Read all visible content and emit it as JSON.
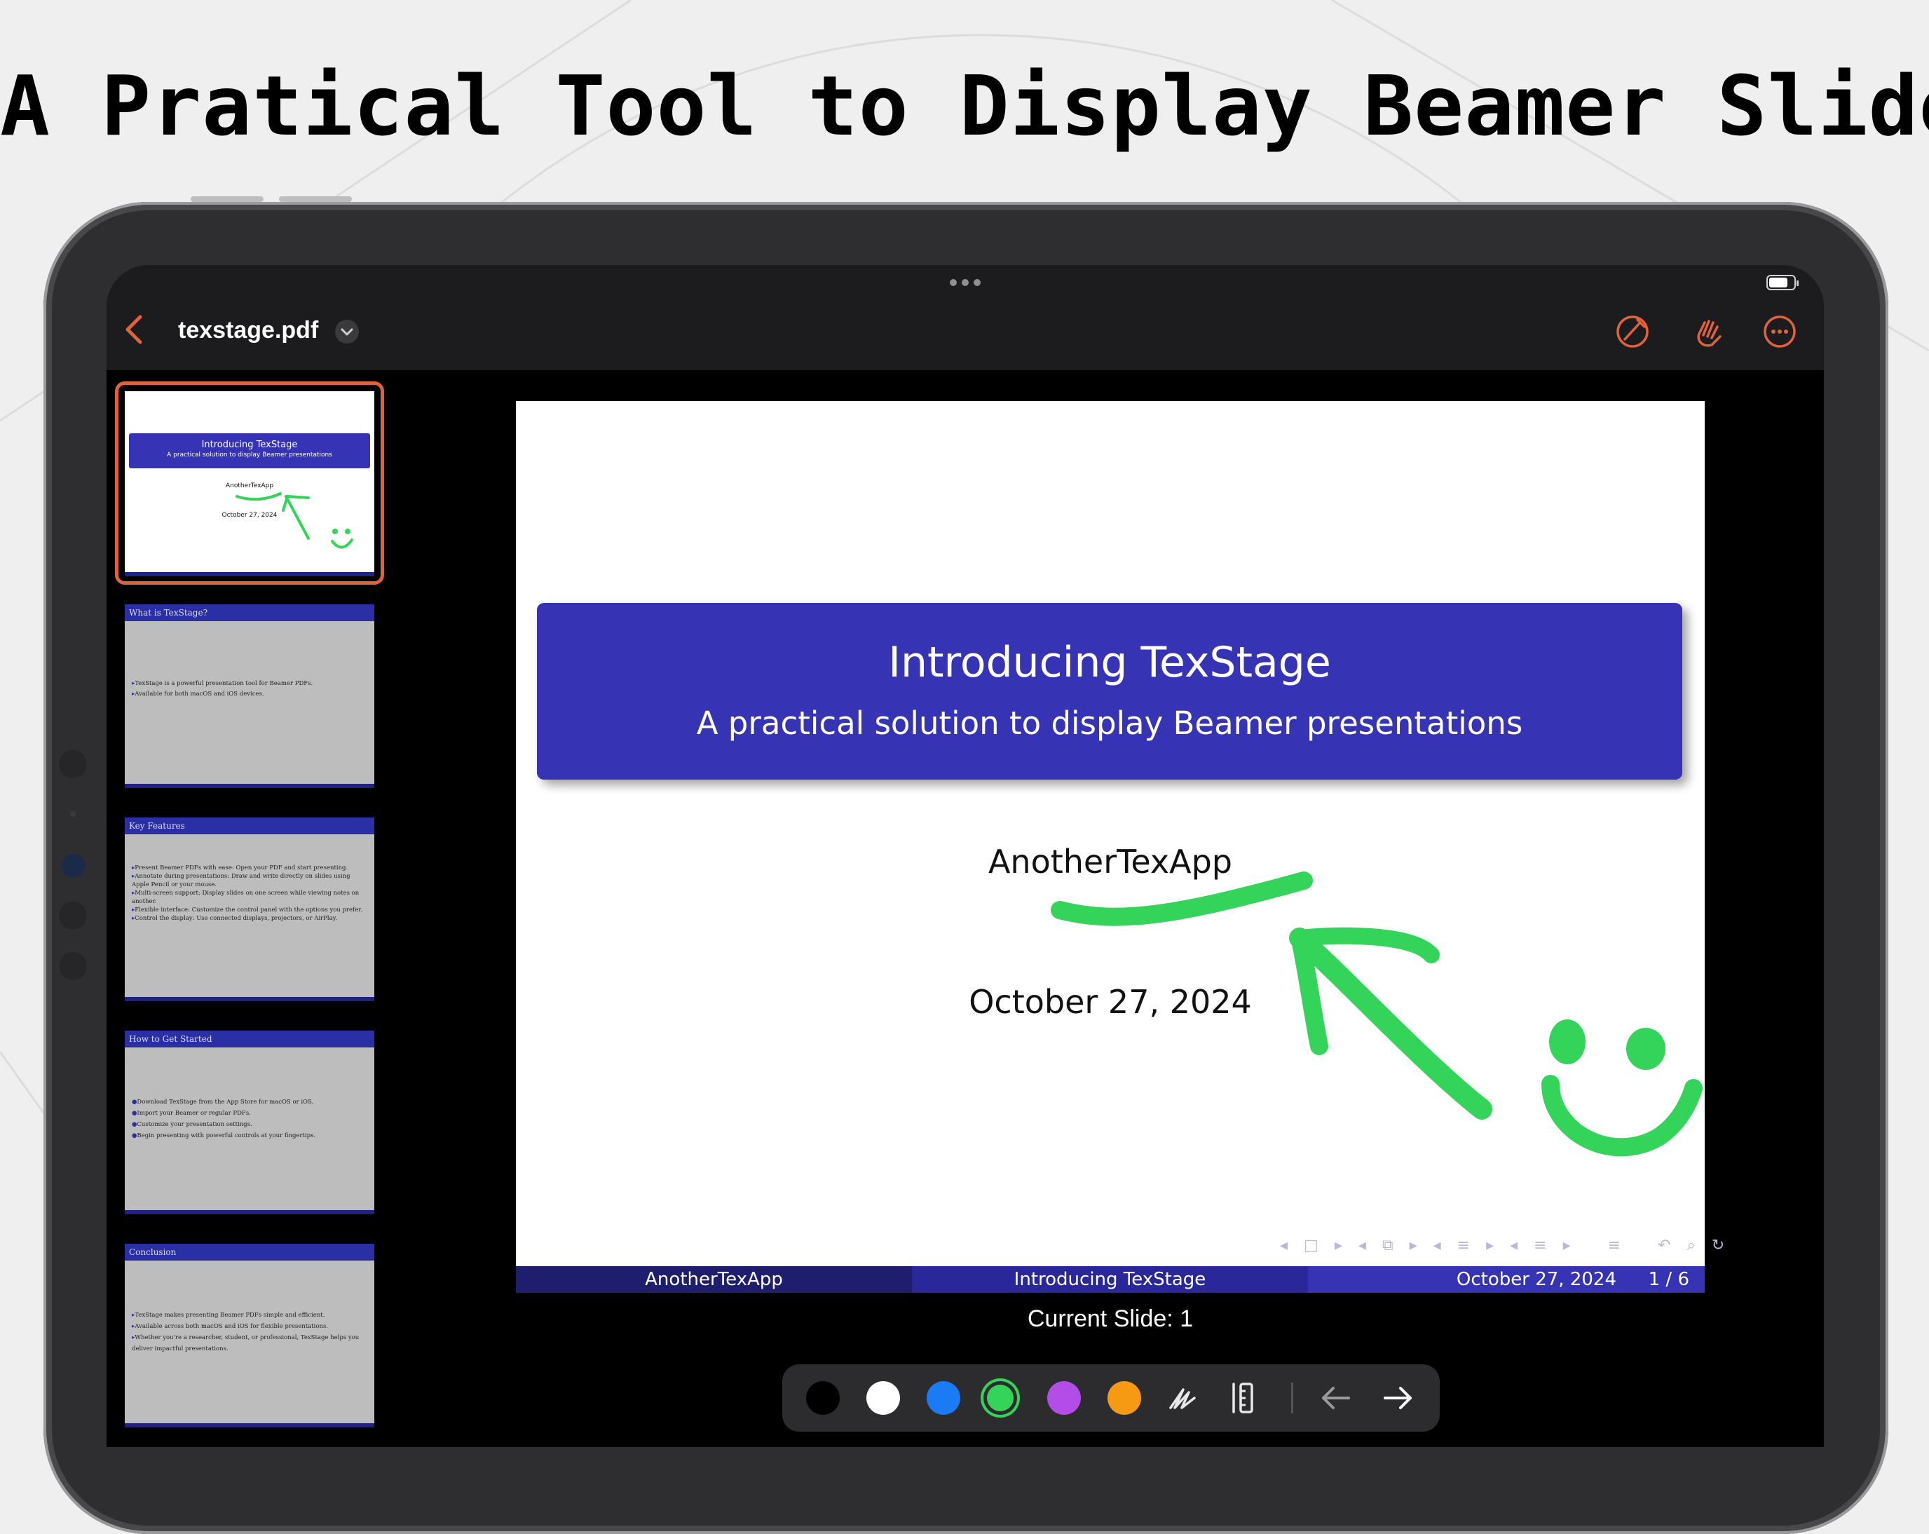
{
  "headline": "A Pratical Tool to Display Beamer Slides",
  "app": {
    "file_name": "texstage.pdf",
    "icons": {
      "back": "chevron-left-icon",
      "file_menu": "chevron-down-icon",
      "annotate": "pencil-slash-icon",
      "hand": "hand-wave-icon",
      "more": "ellipsis-circle-icon"
    },
    "accent_color": "#e0623a"
  },
  "thumbnails": [
    {
      "title": "Introducing TexStage",
      "subtitle": "A practical solution to display Beamer presentations",
      "author": "AnotherTexApp",
      "date": "October 27, 2024",
      "selected": true
    },
    {
      "heading": "What is TexStage?",
      "bullets": [
        "TexStage is a powerful presentation tool for Beamer PDFs.",
        "Available for both macOS and iOS devices."
      ]
    },
    {
      "heading": "Key Features",
      "bullets": [
        "Present Beamer PDFs with ease: Open your PDF and start presenting.",
        "Annotate during presentations: Draw and write directly on slides using Apple Pencil or your mouse.",
        "Multi-screen support: Display slides on one screen while viewing notes on another.",
        "Flexible interface: Customize the control panel with the options you prefer.",
        "Control the display: Use connected displays, projectors, or AirPlay."
      ]
    },
    {
      "heading": "How to Get Started",
      "bullets": [
        "Download TexStage from the App Store for macOS or iOS.",
        "Import your Beamer or regular PDFs.",
        "Customize your presentation settings.",
        "Begin presenting with powerful controls at your fingertips."
      ]
    },
    {
      "heading": "Conclusion",
      "bullets": [
        "TexStage makes presenting Beamer PDFs simple and efficient.",
        "Available across both macOS and iOS for flexible presentations.",
        "Whether you're a researcher, student, or professional, TexStage helps you deliver impactful presentations."
      ]
    }
  ],
  "slide": {
    "title": "Introducing TexStage",
    "subtitle": "A practical solution to display Beamer presentations",
    "author": "AnotherTexApp",
    "date": "October 27, 2024",
    "footer_left": "AnotherTexApp",
    "footer_center": "Introducing TexStage",
    "footer_right": "October 27, 2024",
    "page": "1 / 6",
    "title_color": "#3633b5",
    "annotation_color": "#34d45a"
  },
  "current_slide": "Current Slide: 1",
  "pen_toolbar": {
    "colors": [
      "#000000",
      "#ffffff",
      "#1a7bf5",
      "#34d45a",
      "#b44de8",
      "#f59a12"
    ],
    "selected_color": "#34d45a",
    "icons": [
      "signature-pen-icon",
      "ruler-icon",
      "arrow-left-icon",
      "arrow-right-icon"
    ]
  }
}
